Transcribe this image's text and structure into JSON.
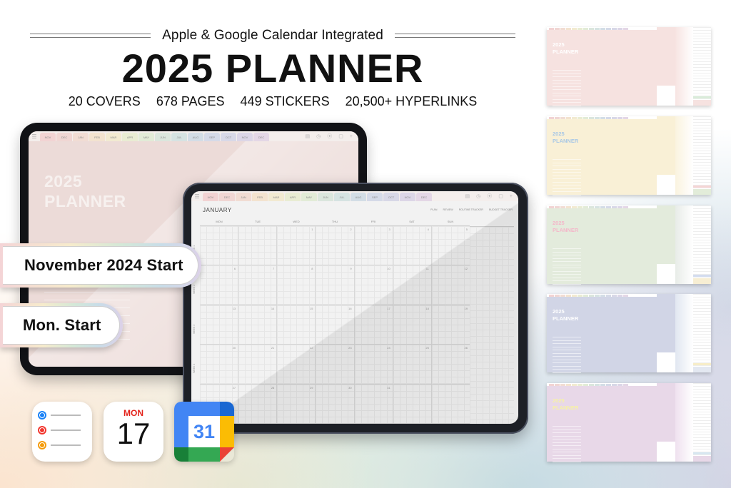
{
  "header": {
    "subtitle": "Apple & Google Calendar Integrated",
    "title": "2025 PLANNER",
    "stats": [
      "20 COVERS",
      "678 PAGES",
      "449 STICKERS",
      "20,500+ HYPERLINKS"
    ]
  },
  "badges": {
    "start_month": "November 2024 Start",
    "week_start": "Mon. Start"
  },
  "tabs": {
    "months": [
      "NOV",
      "DEC",
      "JAN",
      "FEB",
      "MAR",
      "APR",
      "MAY",
      "JUN",
      "JUL",
      "AUG",
      "SEP",
      "OCT",
      "NOV",
      "DEC"
    ],
    "colors": [
      "#f2d3d3",
      "#f0d6d3",
      "#f1dcd3",
      "#f3e3cf",
      "#f2ead1",
      "#e9ecd3",
      "#e2ebd7",
      "#dbe6dd",
      "#d6e3e2",
      "#d3dde6",
      "#d5dae8",
      "#d8d8e7",
      "#dcd6e7",
      "#e4d7e6"
    ],
    "menu_icon": "hamburger-menu-icon",
    "tool_icons": [
      "notes-icon",
      "clock-icon",
      "settings-icon",
      "window-icon",
      "plus-icon"
    ]
  },
  "cover": {
    "title_line1": "2025",
    "title_line2": "PLANNER"
  },
  "calendar": {
    "month": "JANUARY",
    "links": [
      "PLAN",
      "REVIEW",
      "ROUTINE TRACKER",
      "BUDGET TRACKER"
    ],
    "weekdays": [
      "MON",
      "TUE",
      "WED",
      "THU",
      "FRI",
      "SAT",
      "SUN"
    ],
    "weeks": [
      {
        "label": "WEEK 1",
        "days": [
          "",
          "",
          "1",
          "2",
          "3",
          "4",
          "5"
        ]
      },
      {
        "label": "WEEK 2",
        "days": [
          "6",
          "7",
          "8",
          "9",
          "10",
          "11",
          "12"
        ]
      },
      {
        "label": "WEEK 3",
        "days": [
          "13",
          "14",
          "15",
          "16",
          "17",
          "18",
          "19"
        ]
      },
      {
        "label": "WEEK 4",
        "days": [
          "20",
          "21",
          "22",
          "23",
          "24",
          "25",
          "26"
        ]
      },
      {
        "label": "WEEK 5",
        "days": [
          "27",
          "28",
          "29",
          "30",
          "31",
          "",
          ""
        ]
      }
    ]
  },
  "apps": {
    "reminders": {
      "name": "Reminders",
      "dot_colors": [
        "#1a82f7",
        "#f2372f",
        "#f59c0b"
      ]
    },
    "apple_calendar": {
      "day": "MON",
      "date": "17"
    },
    "google_calendar": {
      "date": "31",
      "colors": {
        "blue": "#4285f4",
        "dark_blue": "#1967d2",
        "yellow": "#fbbc04",
        "green": "#34a853",
        "dark_green": "#188038",
        "red": "#ea4335"
      }
    }
  },
  "previews": [
    {
      "title_line1": "2025",
      "title_line2": "PLANNER",
      "bg": "#f6e2e0",
      "title_color": "#ffffff",
      "p3": "#f7e4e2",
      "band1": "#d9ecd9",
      "band2": "#f6e2e0"
    },
    {
      "title_line1": "2025",
      "title_line2": "PLANNER",
      "bg": "#f9f0d6",
      "title_color": "#a9c8e6",
      "p3": "#faf3df",
      "band1": "#f5d5d5",
      "band2": "#e2ecd9"
    },
    {
      "title_line1": "2025",
      "title_line2": "PLANNER",
      "bg": "#e3ebdc",
      "title_color": "#f4b7c9",
      "p3": "#e8ece8",
      "band1": "#d3dcef",
      "band2": "#f7eed3"
    },
    {
      "title_line1": "2025",
      "title_line2": "PLANNER",
      "bg": "#d1d5e6",
      "title_color": "#ffffff",
      "p3": "#e1e7f1",
      "band1": "#f7edc8",
      "band2": "#e3e8f1"
    },
    {
      "title_line1": "2025",
      "title_line2": "PLANNER",
      "bg": "#e8d8e8",
      "title_color": "#f7f2a4",
      "p3": "#efe1ef",
      "band1": "#d7e7f1",
      "band2": "#e8d8e8"
    }
  ]
}
